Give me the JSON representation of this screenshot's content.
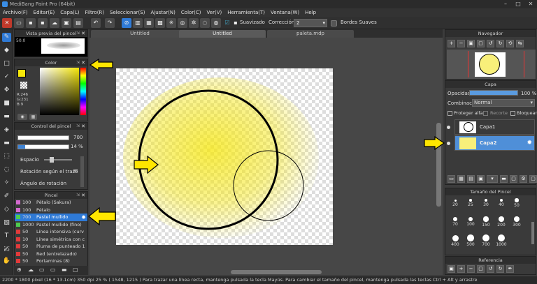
{
  "window": {
    "title": "MediBang Paint Pro (64bit)"
  },
  "menu": [
    "Archivo(F)",
    "Editar(E)",
    "Capa(L)",
    "Filtro(R)",
    "Seleccionar(S)",
    "Ajustar(N)",
    "Color(C)",
    "Ver(V)",
    "Herramienta(T)",
    "Ventana(W)",
    "Help"
  ],
  "toolbar": {
    "antialias_label": "Suavizado",
    "correction_label": "Corrección",
    "correction_value": "2",
    "soft_edges_label": "Bordes Suaves"
  },
  "tabs": [
    "Untitled",
    "Untitled",
    "paleta.mdp"
  ],
  "brush_preview": {
    "title": "Vista previa del pincel",
    "size_value": "50.0"
  },
  "color_panel": {
    "title": "Color",
    "r": "R:246",
    "g": "G:231",
    "b": "B:9",
    "color_hex": "#f6e709"
  },
  "brush_control": {
    "title": "Control del pincel",
    "size": "700",
    "opacity": "14 %",
    "opacity_fraction": 0.14,
    "spacing_label": "Espacio",
    "rotation_label": "Rotación según el trazo",
    "angle_label": "Ángulo de rotación"
  },
  "brush_list": {
    "title": "Pincel",
    "items": [
      {
        "size": "100",
        "name": "Pétalo (Sakura)",
        "color": "#d46ad0"
      },
      {
        "size": "100",
        "name": "Pétalo",
        "color": "#d46ad0"
      },
      {
        "size": "700",
        "name": "Pastel mullido",
        "color": "#4ecb4e",
        "selected": true
      },
      {
        "size": "1000",
        "name": "Pastel mullido (fino)",
        "color": "#4ecb4e"
      },
      {
        "size": "50",
        "name": "Línea intensiva (curv",
        "color": "#e23a3a"
      },
      {
        "size": "10",
        "name": "Línea simétrica con c",
        "color": "#e23a3a"
      },
      {
        "size": "50",
        "name": "Pluma de punteado 1",
        "color": "#e23a3a"
      },
      {
        "size": "50",
        "name": "Red (entrelazado)",
        "color": "#e23a3a"
      },
      {
        "size": "50",
        "name": "Portaminas (8)",
        "color": "#e23a3a"
      }
    ]
  },
  "navigator": {
    "title": "Navegador"
  },
  "layer_panel": {
    "title": "Capa",
    "opacity_label": "Opacidad",
    "opacity_value": "100 %",
    "opacity_fraction": 1.0,
    "blend_label": "Combinación",
    "blend_value": "Normal",
    "protect_alpha": "Proteger alfa",
    "clip": "Recorte",
    "lock": "Bloquear",
    "layers": [
      {
        "name": "Capa1",
        "selected": false
      },
      {
        "name": "Capa2",
        "selected": true
      }
    ]
  },
  "brush_size": {
    "title": "Tamaño del Pincel",
    "sizes": [
      "20",
      "25",
      "30",
      "40",
      "50",
      "70",
      "100",
      "150",
      "200",
      "300",
      "400",
      "500",
      "700",
      "1000"
    ]
  },
  "reference": {
    "title": "Referencia"
  },
  "status": {
    "text": "2200 * 1800 píxel   (16 * 13.1cm)   350 dpi   25 %   ( 1548, 1215 )   Para trazar una línea recta, mantenga pulsada la tecla Mayús. Para cambiar el tamaño del pincel, mantenga pulsada las teclas Ctrl + Alt y arrastre"
  },
  "colors": {
    "accent": "#2f7ad6",
    "arrow": "#ffe600"
  }
}
